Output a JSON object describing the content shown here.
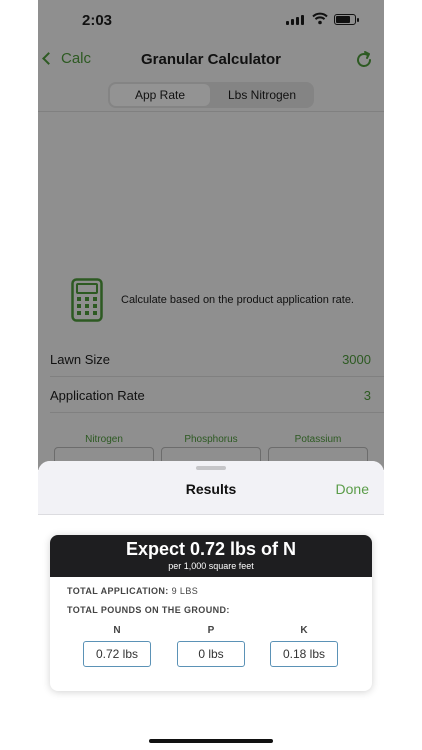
{
  "status_bar": {
    "time": "2:03"
  },
  "nav": {
    "back_label": "Calc",
    "title": "Granular Calculator"
  },
  "segments": [
    {
      "label": "App Rate",
      "selected": true
    },
    {
      "label": "Lbs Nitrogen",
      "selected": false
    }
  ],
  "calc_description": "Calculate based on the product application rate.",
  "fields": [
    {
      "label": "Lawn Size",
      "value": "3000"
    },
    {
      "label": "Application Rate",
      "value": "3"
    }
  ],
  "nutrients": [
    {
      "label": "Nitrogen"
    },
    {
      "label": "Phosphorus"
    },
    {
      "label": "Potassium"
    }
  ],
  "sheet": {
    "title": "Results",
    "done_label": "Done"
  },
  "result": {
    "headline": "Expect 0.72 lbs of N",
    "subline": "per 1,000 square feet",
    "total_application_label": "TOTAL APPLICATION:",
    "total_application_value": "9 LBS",
    "total_ground_label": "TOTAL POUNDS ON THE GROUND:",
    "npk": [
      {
        "label": "N",
        "value": "0.72 lbs"
      },
      {
        "label": "P",
        "value": "0 lbs"
      },
      {
        "label": "K",
        "value": "0.18 lbs"
      }
    ]
  },
  "colors": {
    "accent": "#5a9c48",
    "dimmed_accent": "#2d5a22",
    "result_header": "#1e1e20",
    "result_box_border": "#5b92b6"
  },
  "icons": [
    "chevron-left-icon",
    "refresh-icon",
    "calculator-icon",
    "signal-icon",
    "wifi-icon",
    "battery-icon"
  ]
}
